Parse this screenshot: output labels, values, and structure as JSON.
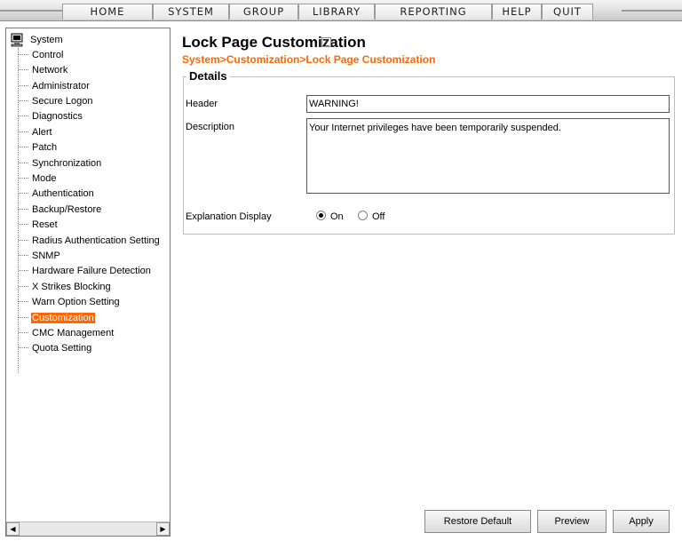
{
  "menu": {
    "items": [
      "HOME",
      "SYSTEM",
      "GROUP",
      "LIBRARY",
      "REPORTING",
      "HELP",
      "QUIT"
    ]
  },
  "sidebar": {
    "root_label": "System",
    "items": [
      "Control",
      "Network",
      "Administrator",
      "Secure Logon",
      "Diagnostics",
      "Alert",
      "Patch",
      "Synchronization",
      "Mode",
      "Authentication",
      "Backup/Restore",
      "Reset",
      "Radius Authentication Setting",
      "SNMP",
      "Hardware Failure Detection",
      "X Strikes Blocking",
      "Warn Option Setting",
      "Customization",
      "CMC Management",
      "Quota Setting"
    ],
    "selected": "Customization",
    "scroll_left_glyph": "◀",
    "scroll_right_glyph": "▶"
  },
  "main": {
    "title": "Lock Page Customization",
    "help_icon_glyph": "?",
    "breadcrumb": "System>Customization>Lock Page Customization",
    "details": {
      "legend": "Details",
      "header_label": "Header",
      "header_value": "WARNING!",
      "description_label": "Description",
      "description_value": "Your Internet privileges have been temporarily suspended.",
      "explanation_label": "Explanation Display",
      "radio_on_label": "On",
      "radio_off_label": "Off",
      "explanation_selected": "On"
    },
    "buttons": {
      "restore_default": "Restore Default",
      "preview": "Preview",
      "apply": "Apply"
    }
  },
  "colors": {
    "accent": "#ff6600",
    "selection_bg": "#ff6600"
  }
}
